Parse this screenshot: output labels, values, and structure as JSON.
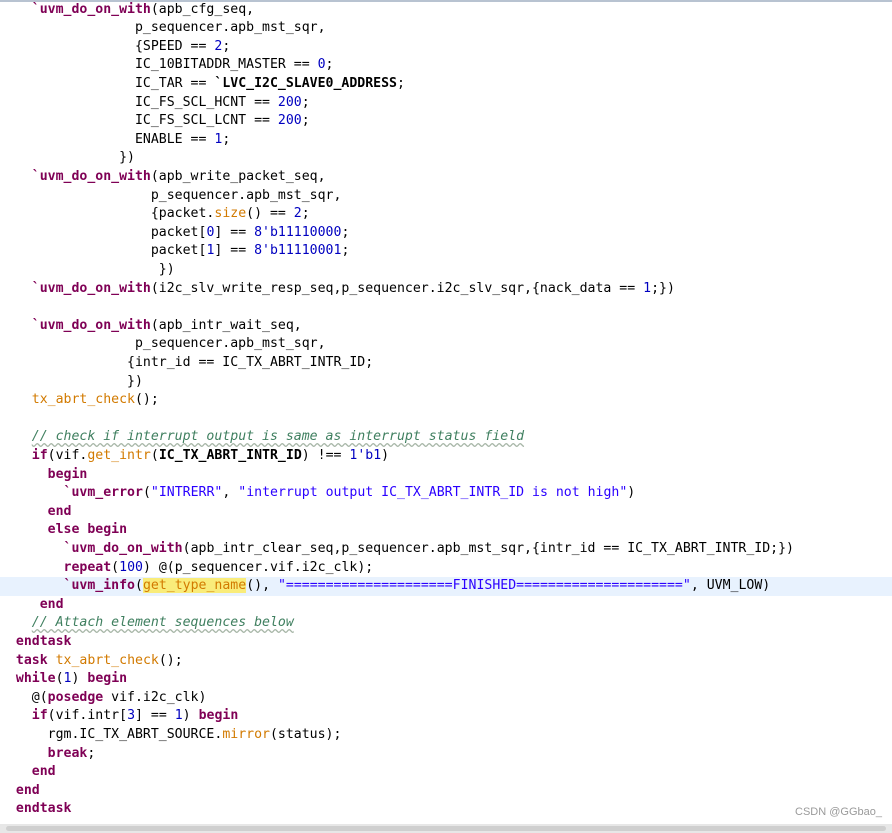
{
  "editor": {
    "lines": [
      {
        "tokens": [
          {
            "t": "    "
          },
          {
            "t": "`uvm_do_on_with",
            "c": "kw"
          },
          {
            "t": "(apb_cfg_seq,"
          }
        ]
      },
      {
        "tokens": [
          {
            "t": "                 p_sequencer.apb_mst_sqr,"
          }
        ]
      },
      {
        "tokens": [
          {
            "t": "                 {SPEED == "
          },
          {
            "t": "2",
            "c": "num"
          },
          {
            "t": ";"
          }
        ]
      },
      {
        "tokens": [
          {
            "t": "                 IC_10BITADDR_MASTER == "
          },
          {
            "t": "0",
            "c": "num"
          },
          {
            "t": ";"
          }
        ]
      },
      {
        "tokens": [
          {
            "t": "                 IC_TAR == "
          },
          {
            "t": "`LVC_I2C_SLAVE0_ADDRESS",
            "c": "bold"
          },
          {
            "t": ";"
          }
        ]
      },
      {
        "tokens": [
          {
            "t": "                 IC_FS_SCL_HCNT == "
          },
          {
            "t": "200",
            "c": "num"
          },
          {
            "t": ";"
          }
        ]
      },
      {
        "tokens": [
          {
            "t": "                 IC_FS_SCL_LCNT == "
          },
          {
            "t": "200",
            "c": "num"
          },
          {
            "t": ";"
          }
        ]
      },
      {
        "tokens": [
          {
            "t": "                 ENABLE == "
          },
          {
            "t": "1",
            "c": "num"
          },
          {
            "t": ";"
          }
        ]
      },
      {
        "tokens": [
          {
            "t": "               })"
          }
        ]
      },
      {
        "tokens": [
          {
            "t": "    "
          },
          {
            "t": "`uvm_do_on_with",
            "c": "kw"
          },
          {
            "t": "(apb_write_packet_seq,"
          }
        ]
      },
      {
        "tokens": [
          {
            "t": "                   p_sequencer.apb_mst_sqr,"
          }
        ]
      },
      {
        "tokens": [
          {
            "t": "                   {packet."
          },
          {
            "t": "size",
            "c": "fn"
          },
          {
            "t": "() == "
          },
          {
            "t": "2",
            "c": "num"
          },
          {
            "t": ";"
          }
        ]
      },
      {
        "tokens": [
          {
            "t": "                   packet["
          },
          {
            "t": "0",
            "c": "num"
          },
          {
            "t": "] == "
          },
          {
            "t": "8'b11110000",
            "c": "num"
          },
          {
            "t": ";"
          }
        ]
      },
      {
        "tokens": [
          {
            "t": "                   packet["
          },
          {
            "t": "1",
            "c": "num"
          },
          {
            "t": "] == "
          },
          {
            "t": "8'b11110001",
            "c": "num"
          },
          {
            "t": ";"
          }
        ]
      },
      {
        "tokens": [
          {
            "t": "                    })"
          }
        ]
      },
      {
        "tokens": [
          {
            "t": "    "
          },
          {
            "t": "`uvm_do_on_with",
            "c": "kw"
          },
          {
            "t": "(i2c_slv_write_resp_seq,p_sequencer.i2c_slv_sqr,{nack_data == "
          },
          {
            "t": "1",
            "c": "num"
          },
          {
            "t": ";})"
          }
        ]
      },
      {
        "tokens": [
          {
            "t": ""
          }
        ]
      },
      {
        "tokens": [
          {
            "t": "    "
          },
          {
            "t": "`uvm_do_on_with",
            "c": "kw"
          },
          {
            "t": "(apb_intr_wait_seq,"
          }
        ]
      },
      {
        "tokens": [
          {
            "t": "                 p_sequencer.apb_mst_sqr,"
          }
        ]
      },
      {
        "tokens": [
          {
            "t": "                {intr_id == IC_TX_ABRT_INTR_ID;"
          }
        ]
      },
      {
        "tokens": [
          {
            "t": "                })"
          }
        ]
      },
      {
        "tokens": [
          {
            "t": "    "
          },
          {
            "t": "tx_abrt_check",
            "c": "fn"
          },
          {
            "t": "();"
          }
        ]
      },
      {
        "tokens": [
          {
            "t": ""
          }
        ]
      },
      {
        "tokens": [
          {
            "t": "    "
          },
          {
            "t": "// check if interrupt output is same as interrupt status field",
            "c": "cmt"
          }
        ]
      },
      {
        "tokens": [
          {
            "t": "    "
          },
          {
            "t": "if",
            "c": "kw"
          },
          {
            "t": "(vif."
          },
          {
            "t": "get_intr",
            "c": "fn"
          },
          {
            "t": "("
          },
          {
            "t": "IC_TX_ABRT_INTR_ID",
            "c": "bold"
          },
          {
            "t": ") !== "
          },
          {
            "t": "1'b1",
            "c": "num"
          },
          {
            "t": ")"
          }
        ]
      },
      {
        "tokens": [
          {
            "t": "      "
          },
          {
            "t": "begin",
            "c": "kw"
          }
        ]
      },
      {
        "tokens": [
          {
            "t": "        "
          },
          {
            "t": "`uvm_error",
            "c": "kw"
          },
          {
            "t": "("
          },
          {
            "t": "\"INTRERR\"",
            "c": "str"
          },
          {
            "t": ", "
          },
          {
            "t": "\"interrupt output IC_TX_ABRT_INTR_ID is not high\"",
            "c": "str"
          },
          {
            "t": ")"
          }
        ]
      },
      {
        "tokens": [
          {
            "t": "      "
          },
          {
            "t": "end",
            "c": "kw"
          }
        ]
      },
      {
        "tokens": [
          {
            "t": "      "
          },
          {
            "t": "else begin",
            "c": "kw"
          }
        ]
      },
      {
        "tokens": [
          {
            "t": "        "
          },
          {
            "t": "`uvm_do_on_with",
            "c": "kw"
          },
          {
            "t": "(apb_intr_clear_seq,p_sequencer.apb_mst_sqr,{intr_id == IC_TX_ABRT_INTR_ID;})"
          }
        ]
      },
      {
        "tokens": [
          {
            "t": "        "
          },
          {
            "t": "repeat",
            "c": "kw"
          },
          {
            "t": "("
          },
          {
            "t": "100",
            "c": "num"
          },
          {
            "t": ") @(p_sequencer.vif.i2c_clk);"
          }
        ]
      },
      {
        "tokens": [
          {
            "t": "        "
          },
          {
            "t": "`uvm_info",
            "c": "kw"
          },
          {
            "t": "("
          },
          {
            "t": "get_type",
            "c": "hl"
          },
          {
            "t": "",
            "c": "caret"
          },
          {
            "t": "_name",
            "c": "hl"
          },
          {
            "t": "(), "
          },
          {
            "t": "\"=====================FINISHED=====================\"",
            "c": "str"
          },
          {
            "t": ", UVM_LOW)"
          }
        ],
        "current": true
      },
      {
        "tokens": [
          {
            "t": "     "
          },
          {
            "t": "end",
            "c": "kw"
          }
        ]
      },
      {
        "tokens": [
          {
            "t": "    "
          },
          {
            "t": "// Attach element sequences below",
            "c": "cmt"
          }
        ]
      },
      {
        "tokens": [
          {
            "t": "  "
          },
          {
            "t": "endtask",
            "c": "kw"
          }
        ]
      },
      {
        "tokens": [
          {
            "t": "  "
          },
          {
            "t": "task",
            "c": "kw"
          },
          {
            "t": " "
          },
          {
            "t": "tx_abrt_check",
            "c": "fn"
          },
          {
            "t": "();"
          }
        ]
      },
      {
        "tokens": [
          {
            "t": "  "
          },
          {
            "t": "while",
            "c": "kw"
          },
          {
            "t": "("
          },
          {
            "t": "1",
            "c": "num"
          },
          {
            "t": ") "
          },
          {
            "t": "begin",
            "c": "kw"
          }
        ]
      },
      {
        "tokens": [
          {
            "t": "    @("
          },
          {
            "t": "posedge",
            "c": "kw"
          },
          {
            "t": " vif.i2c_clk)"
          }
        ]
      },
      {
        "tokens": [
          {
            "t": "    "
          },
          {
            "t": "if",
            "c": "kw"
          },
          {
            "t": "(vif.intr["
          },
          {
            "t": "3",
            "c": "num"
          },
          {
            "t": "] == "
          },
          {
            "t": "1",
            "c": "num"
          },
          {
            "t": ") "
          },
          {
            "t": "begin",
            "c": "kw"
          }
        ]
      },
      {
        "tokens": [
          {
            "t": "      rgm.IC_TX_ABRT_SOURCE."
          },
          {
            "t": "mirror",
            "c": "fn"
          },
          {
            "t": "(status);"
          }
        ]
      },
      {
        "tokens": [
          {
            "t": "      "
          },
          {
            "t": "break",
            "c": "kw"
          },
          {
            "t": ";"
          }
        ]
      },
      {
        "tokens": [
          {
            "t": "    "
          },
          {
            "t": "end",
            "c": "kw"
          }
        ]
      },
      {
        "tokens": [
          {
            "t": "  "
          },
          {
            "t": "end",
            "c": "kw"
          }
        ]
      },
      {
        "tokens": [
          {
            "t": "  "
          },
          {
            "t": "endtask",
            "c": "kw"
          }
        ]
      }
    ]
  },
  "watermark": "CSDN @GGbao_"
}
